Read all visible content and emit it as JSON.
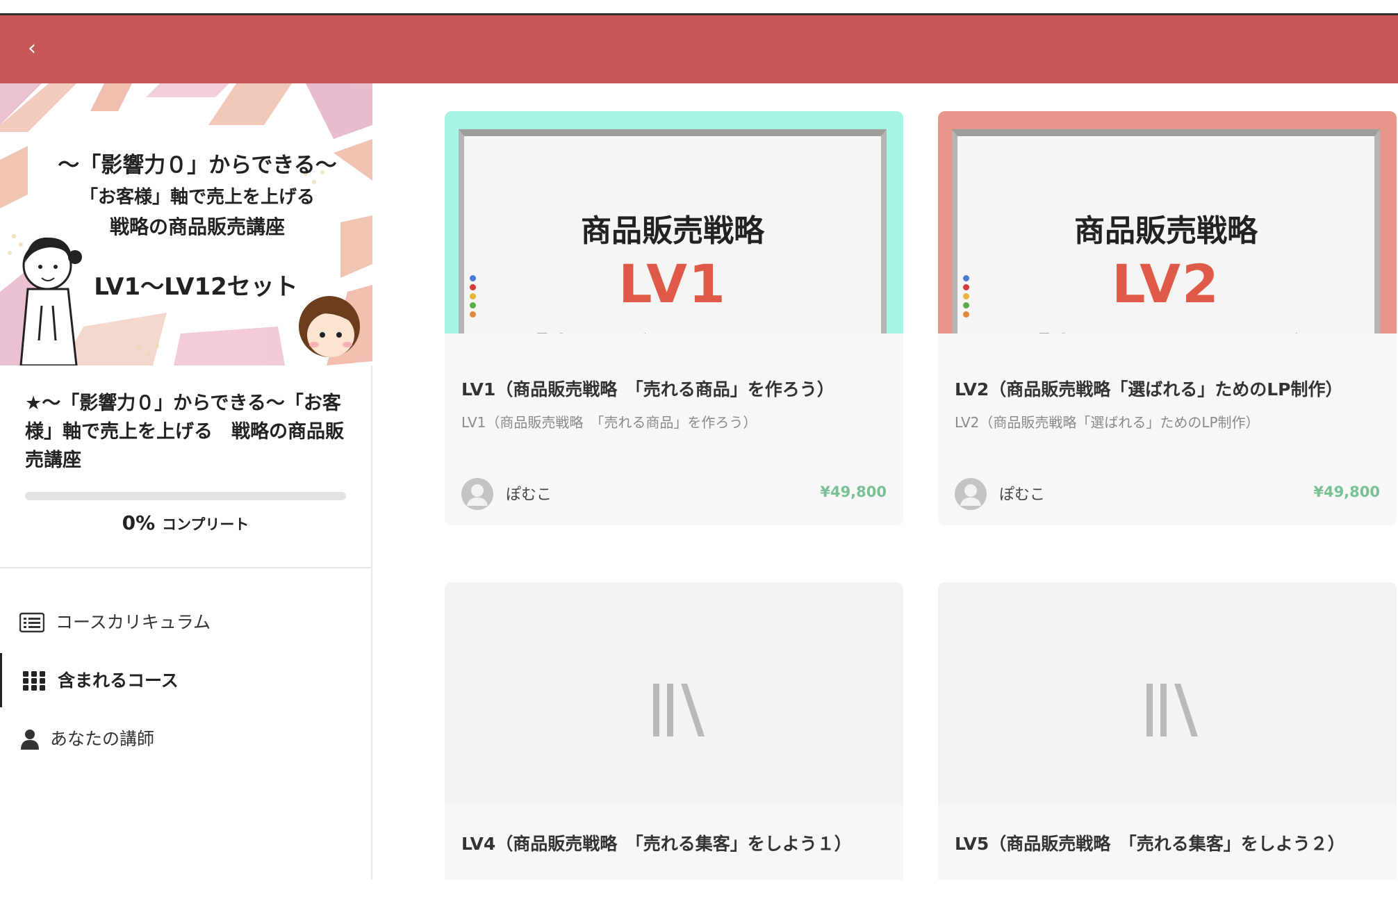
{
  "header": {
    "back_icon": "chevron-left-icon",
    "back_glyph": "‹",
    "color": "#c65755"
  },
  "sidebar": {
    "banner": {
      "line1": "〜「影響力０」からできる〜",
      "line2": "「お客様」軸で売上を上げる",
      "line3": "戦略の商品販売講座",
      "line4": "LV1〜LV12セット"
    },
    "course_title": "★〜「影響力０」からできる〜「お客様」軸で売上を上げる　戦略の商品販売講座",
    "progress": {
      "percent": 0,
      "percent_label": "0%",
      "suffix": "コンプリート"
    },
    "nav": [
      {
        "label": "コースカリキュラム",
        "icon": "curriculum-list-icon",
        "active": false
      },
      {
        "label": "含まれるコース",
        "icon": "grid-icon",
        "active": true
      },
      {
        "label": "あなたの講師",
        "icon": "person-icon",
        "active": false
      }
    ]
  },
  "cards": [
    {
      "title": "LV1（商品販売戦略　「売れる商品」を作ろう）",
      "subtitle": "LV1（商品販売戦略　「売れる商品」を作ろう）",
      "author": "ぽむこ",
      "price": "¥49,800",
      "thumb": {
        "heading": "商品販売戦略",
        "level": "LV1",
        "sub": "「売れる商品」を作ろう",
        "frame_color": "#a8f5e3"
      }
    },
    {
      "title": "LV2（商品販売戦略「選ばれる」ためのLP制作）",
      "subtitle": "LV2（商品販売戦略「選ばれる」ためのLP制作）",
      "author": "ぽむこ",
      "price": "¥49,800",
      "thumb": {
        "heading": "商品販売戦略",
        "level": "LV2",
        "sub": "「売れるLP」の作り方",
        "frame_color": "#e8958c"
      }
    },
    {
      "title": "LV4（商品販売戦略　「売れる集客」をしよう１）",
      "thumb_icon": "library-icon"
    },
    {
      "title": "LV5（商品販売戦略　「売れる集客」をしよう２）",
      "thumb_icon": "library-icon"
    }
  ],
  "colors": {
    "accent": "#c65755",
    "price": "#79c094",
    "level_text": "#e05a4a"
  }
}
